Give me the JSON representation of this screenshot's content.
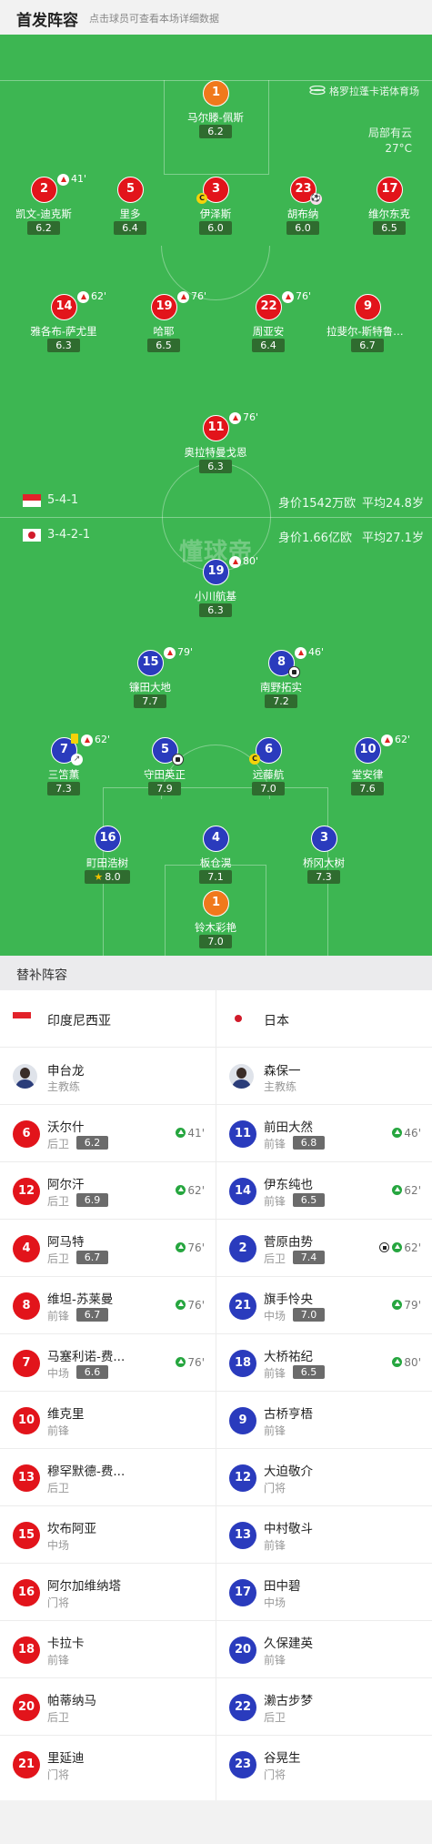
{
  "header": {
    "title": "首发阵容",
    "subtitle": "点击球员可查看本场详细数据"
  },
  "pitch": {
    "stadium": "格罗拉蓬卡诺体育场",
    "weather": "局部有云",
    "temperature": "27°C",
    "watermark": "懂球帝",
    "home": {
      "formation": "5-4-1",
      "value": "身价1542万欧",
      "age": "平均24.8岁"
    },
    "away": {
      "formation": "3-4-2-1",
      "value": "身价1.66亿欧",
      "age": "平均27.1岁"
    }
  },
  "home_players": [
    {
      "num": "1",
      "name": "马尔滕-佩斯",
      "rating": "6.2",
      "color": "orange"
    },
    {
      "num": "2",
      "name": "凯文-迪克斯",
      "rating": "6.2",
      "sub_minute": "41'"
    },
    {
      "num": "5",
      "name": "里多",
      "rating": "6.4"
    },
    {
      "num": "3",
      "name": "伊泽斯",
      "rating": "6.0",
      "captain": "C"
    },
    {
      "num": "23",
      "name": "胡布纳",
      "rating": "6.0"
    },
    {
      "num": "17",
      "name": "维尔东克",
      "rating": "6.5"
    },
    {
      "num": "14",
      "name": "雅各布-萨尤里",
      "rating": "6.3",
      "sub_minute": "62'"
    },
    {
      "num": "19",
      "name": "哈耶",
      "rating": "6.5",
      "sub_minute": "76'"
    },
    {
      "num": "22",
      "name": "周亚安",
      "rating": "6.4",
      "sub_minute": "76'"
    },
    {
      "num": "9",
      "name": "拉斐尔-斯特鲁伊克",
      "rating": "6.7"
    },
    {
      "num": "11",
      "name": "奥拉特曼戈恩",
      "rating": "6.3",
      "sub_minute": "76'"
    }
  ],
  "away_players": [
    {
      "num": "19",
      "name": "小川航基",
      "rating": "6.3",
      "sub_minute": "80'"
    },
    {
      "num": "15",
      "name": "镰田大地",
      "rating": "7.7",
      "sub_minute": "79'"
    },
    {
      "num": "8",
      "name": "南野拓实",
      "rating": "7.2",
      "sub_minute": "46'"
    },
    {
      "num": "7",
      "name": "三笘薫",
      "rating": "7.3",
      "sub_minute": "62'"
    },
    {
      "num": "5",
      "name": "守田英正",
      "rating": "7.9"
    },
    {
      "num": "6",
      "name": "远藤航",
      "rating": "7.0",
      "captain": "C"
    },
    {
      "num": "10",
      "name": "堂安律",
      "rating": "7.6",
      "sub_minute": "62'"
    },
    {
      "num": "16",
      "name": "町田浩树",
      "rating": "8.0"
    },
    {
      "num": "4",
      "name": "板仓滉",
      "rating": "7.1"
    },
    {
      "num": "3",
      "name": "桥冈大树",
      "rating": "7.3"
    },
    {
      "num": "1",
      "name": "铃木彩艳",
      "rating": "7.0",
      "color": "orange"
    }
  ],
  "subs": {
    "title": "替补阵容",
    "home": {
      "team": "印度尼西亚",
      "coach": {
        "name": "申台龙",
        "role": "主教练"
      },
      "players": [
        {
          "num": "6",
          "name": "沃尔什",
          "pos": "后卫",
          "rating": "6.2",
          "in": "41'"
        },
        {
          "num": "12",
          "name": "阿尔汗",
          "pos": "后卫",
          "rating": "6.9",
          "in": "62'"
        },
        {
          "num": "4",
          "name": "阿马特",
          "pos": "后卫",
          "rating": "6.7",
          "in": "76'"
        },
        {
          "num": "8",
          "name": "维坦-苏莱曼",
          "pos": "前锋",
          "rating": "6.7",
          "in": "76'"
        },
        {
          "num": "7",
          "name": "马塞利诺-费...",
          "pos": "中场",
          "rating": "6.6",
          "in": "76'"
        },
        {
          "num": "10",
          "name": "维克里",
          "pos": "前锋"
        },
        {
          "num": "13",
          "name": "穆罕默德-费...",
          "pos": "后卫"
        },
        {
          "num": "15",
          "name": "坎布阿亚",
          "pos": "中场"
        },
        {
          "num": "16",
          "name": "阿尔加维纳塔",
          "pos": "门将"
        },
        {
          "num": "18",
          "name": "卡拉卡",
          "pos": "前锋"
        },
        {
          "num": "20",
          "name": "帕蒂纳马",
          "pos": "后卫"
        },
        {
          "num": "21",
          "name": "里延迪",
          "pos": "门将"
        }
      ]
    },
    "away": {
      "team": "日本",
      "coach": {
        "name": "森保一",
        "role": "主教练"
      },
      "players": [
        {
          "num": "11",
          "name": "前田大然",
          "pos": "前锋",
          "rating": "6.8",
          "in": "46'"
        },
        {
          "num": "14",
          "name": "伊东纯也",
          "pos": "前锋",
          "rating": "6.5",
          "in": "62'"
        },
        {
          "num": "2",
          "name": "菅原由势",
          "pos": "后卫",
          "rating": "7.4",
          "in": "62'"
        },
        {
          "num": "21",
          "name": "旗手怜央",
          "pos": "中场",
          "rating": "7.0",
          "in": "79'"
        },
        {
          "num": "18",
          "name": "大桥祐纪",
          "pos": "前锋",
          "rating": "6.5",
          "in": "80'"
        },
        {
          "num": "9",
          "name": "古桥亨梧",
          "pos": "前锋"
        },
        {
          "num": "12",
          "name": "大迫敬介",
          "pos": "门将"
        },
        {
          "num": "13",
          "name": "中村敬斗",
          "pos": "前锋"
        },
        {
          "num": "17",
          "name": "田中碧",
          "pos": "中场"
        },
        {
          "num": "20",
          "name": "久保建英",
          "pos": "前锋"
        },
        {
          "num": "22",
          "name": "濑古步梦",
          "pos": "后卫"
        },
        {
          "num": "23",
          "name": "谷晃生",
          "pos": "门将"
        }
      ]
    }
  },
  "colors": {
    "pitch": "#3db652",
    "home": "#e2141b",
    "away": "#2a3bbd",
    "keeper": "#f0791c",
    "sub_in": "#26a63f"
  }
}
